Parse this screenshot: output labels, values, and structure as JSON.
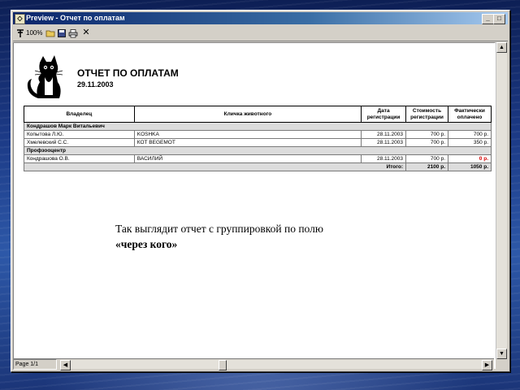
{
  "window": {
    "title": "Preview - Отчет по оплатам",
    "controls": {
      "minimize": "_",
      "maximize": "□",
      "close": "×"
    }
  },
  "toolbar": {
    "zoom_label": "100%",
    "icons": [
      "pin-icon",
      "open-icon",
      "save-icon",
      "print-icon",
      "close-icon"
    ]
  },
  "report": {
    "title": "ОТЧЕТ ПО ОПЛАТАМ",
    "date": "29.11.2003",
    "columns": [
      "Владелец",
      "Кличка животного",
      "Дата регистрации",
      "Стоимость регистрации",
      "Фактически оплачено"
    ],
    "groups": [
      {
        "name": "Кондрашов Марк Витальевич",
        "rows": [
          {
            "owner": "Копытова Л.Ю.",
            "pet": "KOSHKA",
            "date": "28.11.2003",
            "cost": "700 р.",
            "paid": "700 р."
          },
          {
            "owner": "Хмелевский С.С.",
            "pet": "КОТ BEGEMOT",
            "date": "28.11.2003",
            "cost": "700 р.",
            "paid": "350 р."
          }
        ]
      },
      {
        "name": "Профзооцентр",
        "rows": [
          {
            "owner": "Кондрашова О.В.",
            "pet": "ВАСИЛИЙ",
            "date": "28.11.2003",
            "cost": "700 р.",
            "paid": "0 р."
          }
        ]
      }
    ],
    "total": {
      "label": "Итого:",
      "cost": "2100 р.",
      "paid": "1050 р."
    }
  },
  "caption": {
    "line1": "Так выглядит отчет с группировкой по полю",
    "line2": "«через кого»"
  },
  "status": {
    "page": "Page 1/1"
  },
  "colors": {
    "title_bar": "#0a246a",
    "negative_value": "#d40000",
    "window_face": "#d4d0c8"
  }
}
